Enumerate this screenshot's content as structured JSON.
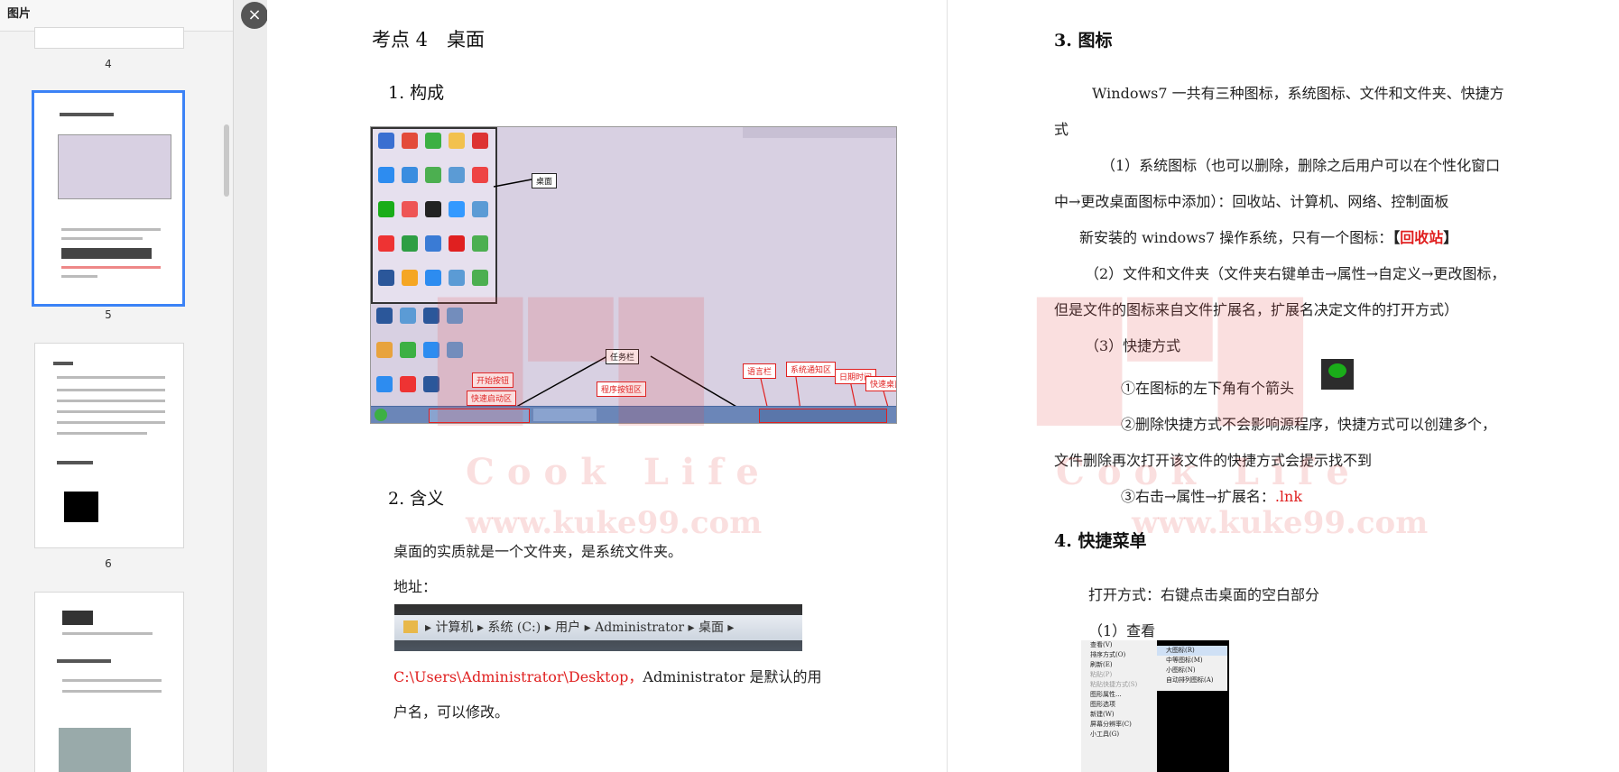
{
  "sidebar": {
    "title": "图片",
    "pages": [
      {
        "num": "4"
      },
      {
        "num": "5"
      },
      {
        "num": "6"
      }
    ]
  },
  "viewer": {
    "close_label": "×"
  },
  "left_page": {
    "section_title": "考点 4　桌面",
    "h_composition": "1. 构成",
    "figure_labels": {
      "desktop": "桌面",
      "taskbar": "任务栏",
      "start": "开始按钮",
      "quicklaunch": "快速启动区",
      "program_buttons": "程序按钮区",
      "language": "语言栏",
      "notify": "系统通知区",
      "datetime": "日期时间",
      "show_desktop": "快速桌面"
    },
    "h_meaning": "2. 含义",
    "meaning_text": "桌面的实质就是一个文件夹，是系统文件夹。",
    "address_label": "地址：",
    "address_crumbs": [
      "计算机",
      "系统 (C:)",
      "用户",
      "Administrator",
      "桌面"
    ],
    "path_red": "C:\\Users\\Administrator\\Desktop，",
    "path_rest": "Administrator 是默认的用",
    "path_line2": "户名，可以修改。"
  },
  "right_page": {
    "h_icons": "3. 图标",
    "p1": "Windows7 一共有三种图标，系统图标、文件和文件夹、快捷方",
    "p1b": "式",
    "p2": "（1）系统图标（也可以删除，删除之后用户可以在个性化窗口",
    "p2b": "中→更改桌面图标中添加）：回收站、计算机、网络、控制面板",
    "p3_pre": "新安装的 windows7 操作系统，只有一个图标：",
    "p3_bracket_open": "【",
    "p3_red": "回收站",
    "p3_bracket_close": "】",
    "p4": "（2）文件和文件夹（文件夹右键单击→属性→自定义→更改图标，",
    "p4b": "但是文件的图标来自文件扩展名，扩展名决定文件的打开方式）",
    "p5": "（3）快捷方式",
    "p6": "①在图标的左下角有个箭头",
    "p7": "②删除快捷方式不会影响源程序，快捷方式可以创建多个，",
    "p7b": "文件删除再次打开该文件的快捷方式会提示找不到",
    "p8_pre": "③右击→属性→扩展名：",
    "p8_red": ".lnk",
    "h_menu": "4. 快捷菜单",
    "p9": "打开方式：右键点击桌面的空白部分",
    "p10": "（1）查看",
    "menu_items": [
      "查看(V)",
      "排序方式(O)",
      "刷新(E)",
      "粘贴(P)",
      "粘贴快捷方式(S)",
      "图形属性...",
      "图形选项",
      "新建(W)",
      "屏幕分辨率(C)",
      "小工具(G)"
    ],
    "submenu_items": [
      "大图标(R)",
      "中等图标(M)",
      "小图标(N)",
      "自动排列图标(A)"
    ]
  },
  "watermark": {
    "en": "Cook Life",
    "url": "www.kuke99.com"
  },
  "colors": {
    "accent_blue": "#3b82f6",
    "red_text": "#e02020",
    "desktop_bg": "#d8d0e2"
  }
}
